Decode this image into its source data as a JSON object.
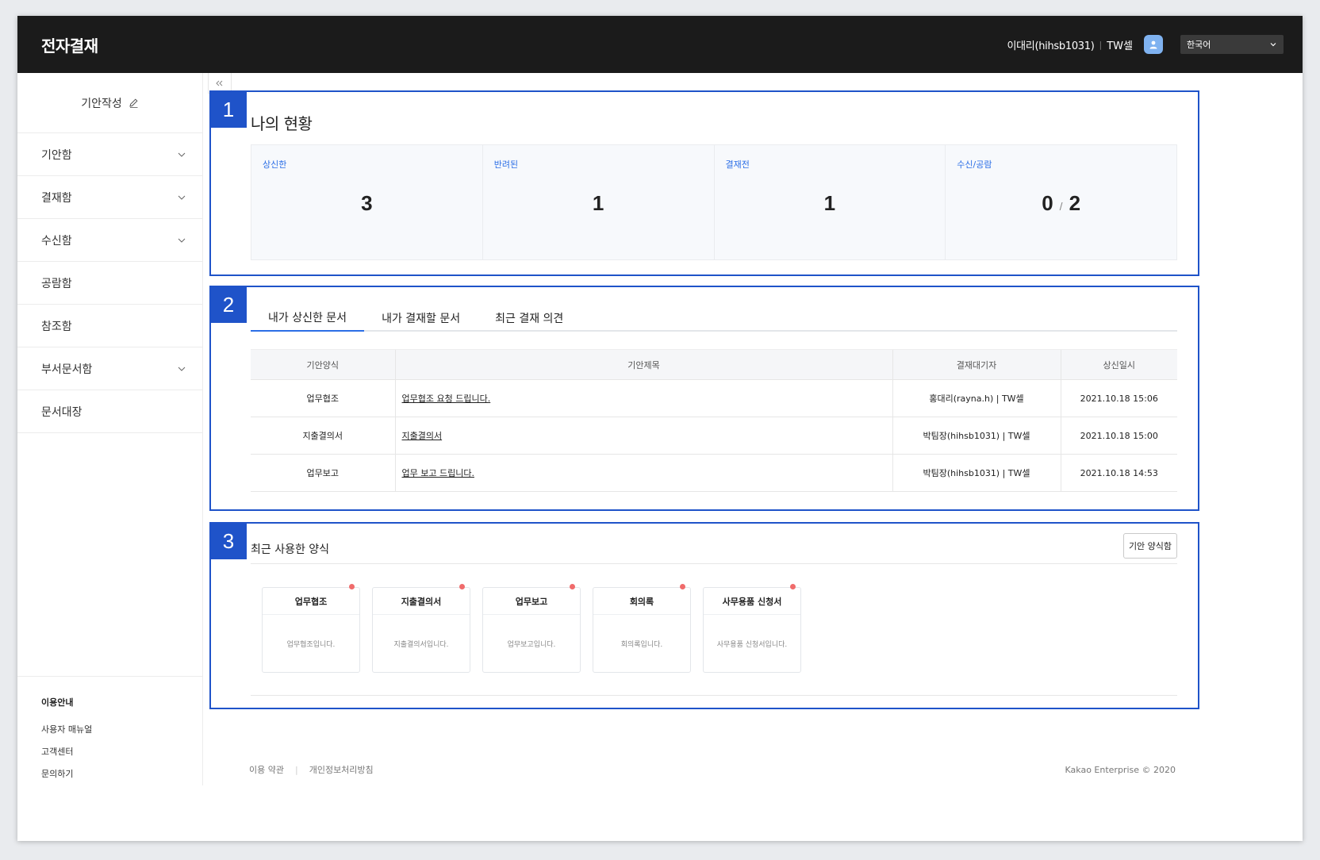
{
  "app": {
    "title": "전자결재"
  },
  "user": {
    "name": "이대리(hihsb1031)",
    "separator": "|",
    "team": "TW셀"
  },
  "language": {
    "selected": "한국어"
  },
  "sidebar": {
    "compose_label": "기안작성",
    "items": [
      {
        "label": "기안함",
        "expandable": true
      },
      {
        "label": "결재함",
        "expandable": true
      },
      {
        "label": "수신함",
        "expandable": true
      },
      {
        "label": "공람함",
        "expandable": false
      },
      {
        "label": "참조함",
        "expandable": false
      },
      {
        "label": "부서문서함",
        "expandable": true
      },
      {
        "label": "문서대장",
        "expandable": false
      }
    ],
    "help": {
      "title": "이용안내",
      "links": [
        "사용자 매뉴얼",
        "고객센터",
        "문의하기"
      ]
    }
  },
  "panel1": {
    "badge": "1",
    "title": "나의 현황",
    "stats": [
      {
        "label": "상신한",
        "value": "3"
      },
      {
        "label": "반려된",
        "value": "1"
      },
      {
        "label": "결재전",
        "value": "1"
      },
      {
        "label": "수신/공람",
        "value_a": "0",
        "value_b": "2"
      }
    ]
  },
  "panel2": {
    "badge": "2",
    "tabs": [
      "내가 상신한 문서",
      "내가 결재할 문서",
      "최근 결재 의견"
    ],
    "active_tab": 0,
    "columns": [
      "기안양식",
      "기안제목",
      "결재대기자",
      "상신일시"
    ],
    "rows": [
      {
        "form": "업무협조",
        "title": "업무협조 요청 드립니다.",
        "approver": "홍대리(rayna.h) | TW셀",
        "date": "2021.10.18 15:06"
      },
      {
        "form": "지출결의서",
        "title": "지출결의서",
        "approver": "박팀장(hihsb1031) | TW셀",
        "date": "2021.10.18 15:00"
      },
      {
        "form": "업무보고",
        "title": "업무 보고 드립니다.",
        "approver": "박팀장(hihsb1031) | TW셀",
        "date": "2021.10.18 14:53"
      }
    ]
  },
  "panel3": {
    "badge": "3",
    "title": "최근 사용한 양식",
    "button": "기안 양식함",
    "cards": [
      {
        "name": "업무협조",
        "desc": "업무협조입니다."
      },
      {
        "name": "지출결의서",
        "desc": "지출결의서입니다."
      },
      {
        "name": "업무보고",
        "desc": "업무보고입니다."
      },
      {
        "name": "회의록",
        "desc": "회의록입니다."
      },
      {
        "name": "사무용품 신청서",
        "desc": "사무용품 신청서입니다."
      }
    ]
  },
  "footer": {
    "terms": "이용 약관",
    "privacy": "개인정보처리방침",
    "copyright": "Kakao Enterprise © 2020"
  },
  "colors": {
    "accent": "#1f53c9",
    "link": "#2b6ee6",
    "topbar": "#1b1b1b",
    "new_dot": "#f06b6b"
  }
}
